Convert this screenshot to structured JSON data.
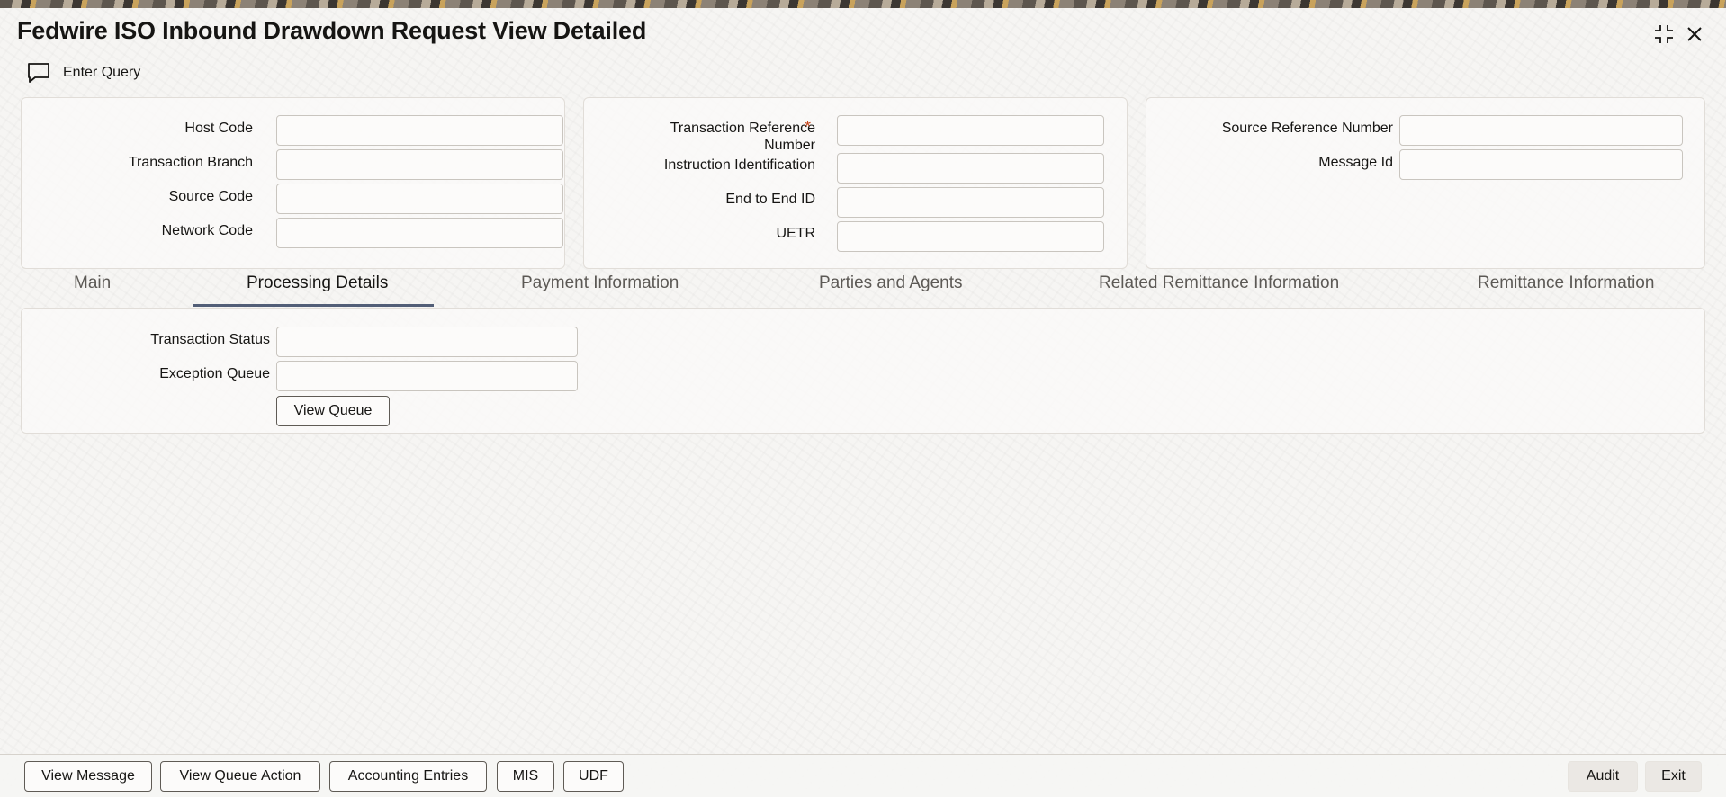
{
  "window": {
    "title": "Fedwire ISO Inbound Drawdown Request View Detailed",
    "icons": [
      "collapse-icon",
      "close-icon"
    ]
  },
  "toolbar": {
    "enter_query_label": "Enter Query",
    "enter_query_icon": "chat-bubble-icon"
  },
  "header": {
    "col1": {
      "host_code": {
        "label": "Host Code",
        "value": ""
      },
      "transaction_branch": {
        "label": "Transaction Branch",
        "value": ""
      },
      "source_code": {
        "label": "Source Code",
        "value": ""
      },
      "network_code": {
        "label": "Network Code",
        "value": ""
      }
    },
    "col2": {
      "transaction_reference_line1": "Transaction Reference",
      "transaction_reference_line2": "Number",
      "transaction_reference_required": "*",
      "transaction_reference_value": "",
      "instruction_identification": {
        "label": "Instruction Identification",
        "value": ""
      },
      "end_to_end_id": {
        "label": "End to End ID",
        "value": ""
      },
      "uetr": {
        "label": "UETR",
        "value": ""
      }
    },
    "col3": {
      "source_reference_number": {
        "label": "Source Reference Number",
        "value": ""
      },
      "message_id": {
        "label": "Message Id",
        "value": ""
      }
    }
  },
  "tabs": [
    {
      "label": "Main",
      "active": false
    },
    {
      "label": "Processing Details",
      "active": true
    },
    {
      "label": "Payment Information",
      "active": false
    },
    {
      "label": "Parties and Agents",
      "active": false
    },
    {
      "label": "Related Remittance Information",
      "active": false
    },
    {
      "label": "Remittance Information",
      "active": false
    }
  ],
  "processing": {
    "transaction_status": {
      "label": "Transaction Status",
      "value": ""
    },
    "exception_queue": {
      "label": "Exception Queue",
      "value": ""
    },
    "view_queue_label": "View Queue"
  },
  "footer": {
    "left_buttons": [
      "View Message",
      "View Queue Action",
      "Accounting Entries",
      "MIS",
      "UDF"
    ],
    "right_buttons": [
      "Audit",
      "Exit"
    ]
  },
  "colors": {
    "accent_underline": "#525e77",
    "required_star": "#c4441a",
    "background": "#f6f5f3"
  }
}
